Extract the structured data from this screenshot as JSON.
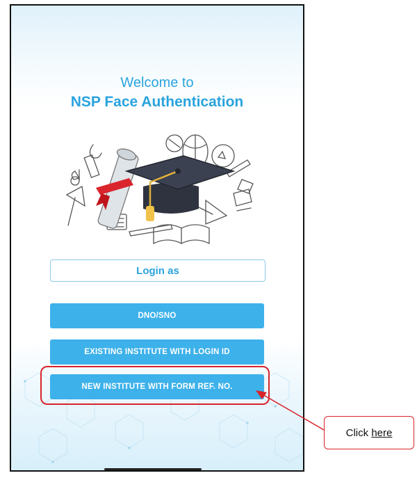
{
  "screen": {
    "welcome_text": "Welcome to",
    "app_title": "NSP Face Authentication"
  },
  "illustration": {
    "icon": "graduation-cap-diploma-illustration"
  },
  "login": {
    "label": "Login as",
    "options": [
      {
        "label": "DNO/SNO"
      },
      {
        "label": "EXISTING INSTITUTE WITH LOGIN ID"
      },
      {
        "label": "NEW INSTITUTE WITH FORM REF. NO."
      }
    ]
  },
  "annotation": {
    "prefix": "Click ",
    "link": "here",
    "color": "#d9232a"
  },
  "colors": {
    "accent": "#2aa3de",
    "button": "#3db1ea",
    "highlight": "#d9232a"
  }
}
